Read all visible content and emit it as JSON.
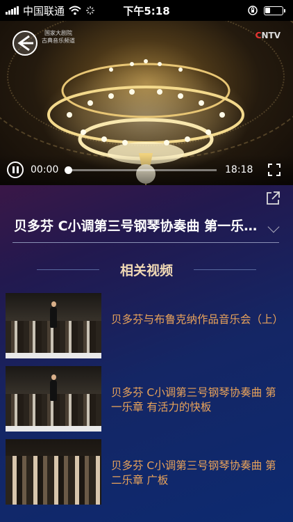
{
  "status_bar": {
    "carrier": "中国联通",
    "time": "下午5:18",
    "battery_level": 0.3
  },
  "player": {
    "logo_lines": [
      "国家大剧院",
      "古典音乐频道"
    ],
    "network_logo_prefix": "C",
    "network_logo_rest": "NTV",
    "current_time": "00:00",
    "duration": "18:18",
    "progress": 0.0,
    "icons": [
      "back-arrow-icon",
      "pause-icon",
      "fullscreen-icon"
    ]
  },
  "detail": {
    "title": "贝多芬 C小调第三号钢琴协奏曲 第一乐章 有活力的快板",
    "icons": [
      "share-icon",
      "chevron-down-icon"
    ]
  },
  "related": {
    "heading": "相关视频",
    "items": [
      {
        "title": "贝多芬与布鲁克纳作品音乐会（上）"
      },
      {
        "title": "贝多芬 C小调第三号钢琴协奏曲 第一乐章 有活力的快板"
      },
      {
        "title": "贝多芬 C小调第三号钢琴协奏曲 第二乐章 广板"
      }
    ]
  },
  "colors": {
    "accent_title": "#e9a35a",
    "section_heading": "#f0d9b5",
    "panel_bg": "#142665"
  }
}
